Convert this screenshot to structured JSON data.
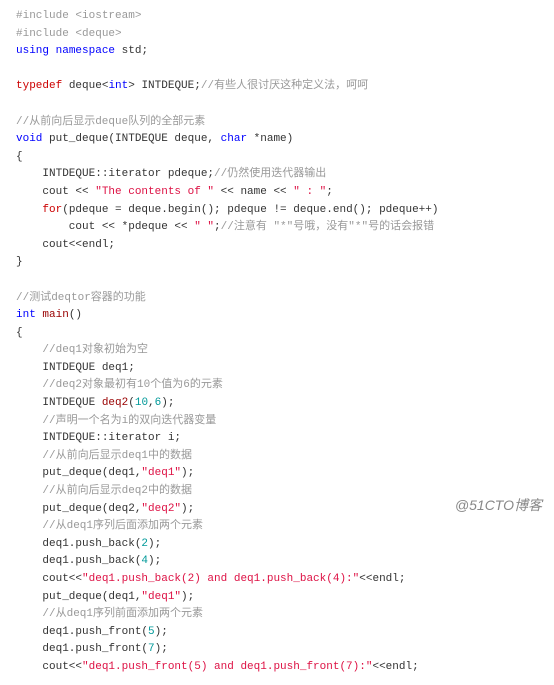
{
  "code": {
    "lines": [
      [
        {
          "t": "#include <iostream>",
          "c": "kw-preproc"
        }
      ],
      [
        {
          "t": "#include <deque>",
          "c": "kw-preproc"
        }
      ],
      [
        {
          "t": "using",
          "c": "kw-blue"
        },
        {
          "t": " ",
          "c": "plain"
        },
        {
          "t": "namespace",
          "c": "kw-blue"
        },
        {
          "t": " std;",
          "c": "plain"
        }
      ],
      [],
      [
        {
          "t": "typedef",
          "c": "kw-red"
        },
        {
          "t": " deque<",
          "c": "plain"
        },
        {
          "t": "int",
          "c": "kw-blue"
        },
        {
          "t": "> INTDEQUE;",
          "c": "plain"
        },
        {
          "t": "//有些人很讨厌这种定义法，呵呵",
          "c": "kw-comment"
        }
      ],
      [],
      [
        {
          "t": "//从前向后显示deque队列的全部元素",
          "c": "kw-comment"
        }
      ],
      [
        {
          "t": "void",
          "c": "kw-blue"
        },
        {
          "t": " put_deque(INTDEQUE deque, ",
          "c": "plain"
        },
        {
          "t": "char",
          "c": "kw-blue"
        },
        {
          "t": " *name)",
          "c": "plain"
        }
      ],
      [
        {
          "t": "{",
          "c": "plain"
        }
      ],
      [
        {
          "t": "    INTDEQUE::iterator pdeque;",
          "c": "plain"
        },
        {
          "t": "//仍然使用迭代器输出",
          "c": "kw-comment"
        }
      ],
      [
        {
          "t": "    cout << ",
          "c": "plain"
        },
        {
          "t": "\"The contents of \"",
          "c": "kw-str"
        },
        {
          "t": " << name << ",
          "c": "plain"
        },
        {
          "t": "\" : \"",
          "c": "kw-str"
        },
        {
          "t": ";",
          "c": "plain"
        }
      ],
      [
        {
          "t": "    ",
          "c": "plain"
        },
        {
          "t": "for",
          "c": "kw-red"
        },
        {
          "t": "(pdeque = deque.begin(); pdeque != deque.end(); pdeque++)",
          "c": "plain"
        }
      ],
      [
        {
          "t": "        cout << *pdeque << ",
          "c": "plain"
        },
        {
          "t": "\" \"",
          "c": "kw-str"
        },
        {
          "t": ";",
          "c": "plain"
        },
        {
          "t": "//注意有 \"*\"号哦，没有\"*\"号的话会报错",
          "c": "kw-comment"
        }
      ],
      [
        {
          "t": "    cout<<endl;",
          "c": "plain"
        }
      ],
      [
        {
          "t": "}",
          "c": "plain"
        }
      ],
      [],
      [
        {
          "t": "//测试deqtor容器的功能",
          "c": "kw-comment"
        }
      ],
      [
        {
          "t": "int",
          "c": "kw-blue"
        },
        {
          "t": " ",
          "c": "plain"
        },
        {
          "t": "main",
          "c": "kw-func"
        },
        {
          "t": "()",
          "c": "plain"
        }
      ],
      [
        {
          "t": "{",
          "c": "plain"
        }
      ],
      [
        {
          "t": "    ",
          "c": "plain"
        },
        {
          "t": "//deq1对象初始为空",
          "c": "kw-comment"
        }
      ],
      [
        {
          "t": "    INTDEQUE deq1;",
          "c": "plain"
        }
      ],
      [
        {
          "t": "    ",
          "c": "plain"
        },
        {
          "t": "//deq2对象最初有10个值为6的元素",
          "c": "kw-comment"
        }
      ],
      [
        {
          "t": "    INTDEQUE ",
          "c": "plain"
        },
        {
          "t": "deq2",
          "c": "kw-func"
        },
        {
          "t": "(",
          "c": "plain"
        },
        {
          "t": "10",
          "c": "kw-num"
        },
        {
          "t": ",",
          "c": "plain"
        },
        {
          "t": "6",
          "c": "kw-num"
        },
        {
          "t": ");",
          "c": "plain"
        }
      ],
      [
        {
          "t": "    ",
          "c": "plain"
        },
        {
          "t": "//声明一个名为i的双向迭代器变量",
          "c": "kw-comment"
        }
      ],
      [
        {
          "t": "    INTDEQUE::iterator i;",
          "c": "plain"
        }
      ],
      [
        {
          "t": "    ",
          "c": "plain"
        },
        {
          "t": "//从前向后显示deq1中的数据",
          "c": "kw-comment"
        }
      ],
      [
        {
          "t": "    put_deque(deq1,",
          "c": "plain"
        },
        {
          "t": "\"deq1\"",
          "c": "kw-str"
        },
        {
          "t": ");",
          "c": "plain"
        }
      ],
      [
        {
          "t": "    ",
          "c": "plain"
        },
        {
          "t": "//从前向后显示deq2中的数据",
          "c": "kw-comment"
        }
      ],
      [
        {
          "t": "    put_deque(deq2,",
          "c": "plain"
        },
        {
          "t": "\"deq2\"",
          "c": "kw-str"
        },
        {
          "t": ");",
          "c": "plain"
        }
      ],
      [
        {
          "t": "    ",
          "c": "plain"
        },
        {
          "t": "//从deq1序列后面添加两个元素",
          "c": "kw-comment"
        }
      ],
      [
        {
          "t": "    deq1.push_back(",
          "c": "plain"
        },
        {
          "t": "2",
          "c": "kw-num"
        },
        {
          "t": ");",
          "c": "plain"
        }
      ],
      [
        {
          "t": "    deq1.push_back(",
          "c": "plain"
        },
        {
          "t": "4",
          "c": "kw-num"
        },
        {
          "t": ");",
          "c": "plain"
        }
      ],
      [
        {
          "t": "    cout<<",
          "c": "plain"
        },
        {
          "t": "\"deq1.push_back(2) and deq1.push_back(4):\"",
          "c": "kw-str"
        },
        {
          "t": "<<endl;",
          "c": "plain"
        }
      ],
      [
        {
          "t": "    put_deque(deq1,",
          "c": "plain"
        },
        {
          "t": "\"deq1\"",
          "c": "kw-str"
        },
        {
          "t": ");",
          "c": "plain"
        }
      ],
      [
        {
          "t": "    ",
          "c": "plain"
        },
        {
          "t": "//从deq1序列前面添加两个元素",
          "c": "kw-comment"
        }
      ],
      [
        {
          "t": "    deq1.push_front(",
          "c": "plain"
        },
        {
          "t": "5",
          "c": "kw-num"
        },
        {
          "t": ");",
          "c": "plain"
        }
      ],
      [
        {
          "t": "    deq1.push_front(",
          "c": "plain"
        },
        {
          "t": "7",
          "c": "kw-num"
        },
        {
          "t": ");",
          "c": "plain"
        }
      ],
      [
        {
          "t": "    cout<<",
          "c": "plain"
        },
        {
          "t": "\"deq1.push_front(5) and deq1.push_front(7):\"",
          "c": "kw-str"
        },
        {
          "t": "<<endl;",
          "c": "plain"
        }
      ]
    ]
  },
  "watermark": "@51CTO博客"
}
